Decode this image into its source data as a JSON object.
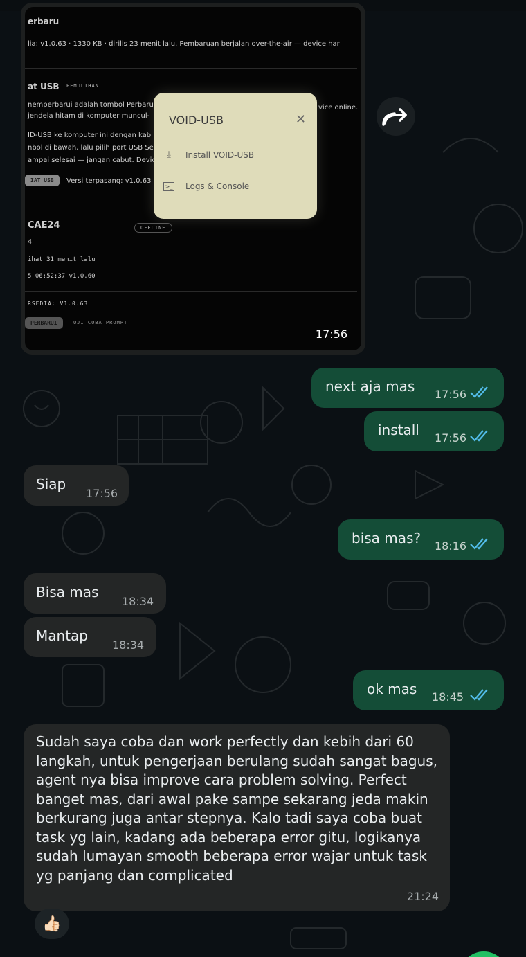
{
  "media_message": {
    "screenshot_lines": {
      "update_heading": "erbaru",
      "update_info": "lia: v1.0.63 · 1330 KB · dirilis 23 menit lalu. Pembaruan berjalan over-the-air — device har",
      "usb_heading": "at USB",
      "usb_badge": "PEMULIHAN",
      "usb_line1": "nemperbarui adalah tombol Perbaru",
      "usb_line1_tail": "vice online.",
      "usb_line2": "jendela hitam di komputer muncul-",
      "usb_line3": "ID-USB ke komputer ini dengan kab",
      "usb_line4": "nbol di bawah, lalu pilih port USB Se",
      "usb_line5": "ampai selesai — jangan cabut. Devic",
      "usb_button": "IAT USB",
      "installed_version": "Versi terpasang: v1.0.63",
      "device_name": "CAE24",
      "device_status": "OFFLINE",
      "device_line1": "4",
      "device_line2": "ihat 31 menit lalu",
      "device_line3": "5 06:52:37 v1.0.60",
      "available": "RSEDIA: V1.0.63",
      "update_button": "PERBARUI",
      "test_prompt": "UJI COBA PROMPT"
    },
    "popup": {
      "title": "VOID-USB",
      "close_icon": "close-icon",
      "items": [
        {
          "icon": "download-icon",
          "label": "Install VOID-USB"
        },
        {
          "icon": "terminal-icon",
          "label": "Logs & Console"
        }
      ]
    },
    "time": "17:56"
  },
  "messages": [
    {
      "direction": "out",
      "text": "next aja mas",
      "time": "17:56",
      "status": "read"
    },
    {
      "direction": "out",
      "text": "install",
      "time": "17:56",
      "status": "read"
    },
    {
      "direction": "in",
      "text": "Siap",
      "time": "17:56"
    },
    {
      "direction": "out",
      "text": "bisa mas?",
      "time": "18:16",
      "status": "read"
    },
    {
      "direction": "in",
      "text": "Bisa mas",
      "time": "18:34"
    },
    {
      "direction": "in",
      "text": "Mantap",
      "time": "18:34"
    },
    {
      "direction": "out",
      "text": "ok mas",
      "time": "18:45",
      "status": "read"
    },
    {
      "direction": "in",
      "text": "Sudah saya coba dan work perfectly dan kebih dari 60 langkah, untuk pengerjaan berulang sudah sangat bagus, agent nya bisa improve cara problem solving. Perfect banget mas, dari awal pake sampe sekarang jeda makin berkurang juga antar stepnya. Kalo tadi saya coba buat task yg lain, kadang ada beberapa error gitu, logikanya sudah lumayan smooth beberapa error wajar untuk task yg panjang dan complicated",
      "time": "21:24"
    }
  ],
  "reaction": "👍🏻",
  "icons": {
    "forward": "forward-icon",
    "read_receipt": "double-check-icon"
  },
  "colors": {
    "background": "#0b1014",
    "outgoing_bubble": "#144d37",
    "incoming_bubble": "#242626",
    "read_tick": "#53bdeb",
    "fab": "#21c063"
  }
}
